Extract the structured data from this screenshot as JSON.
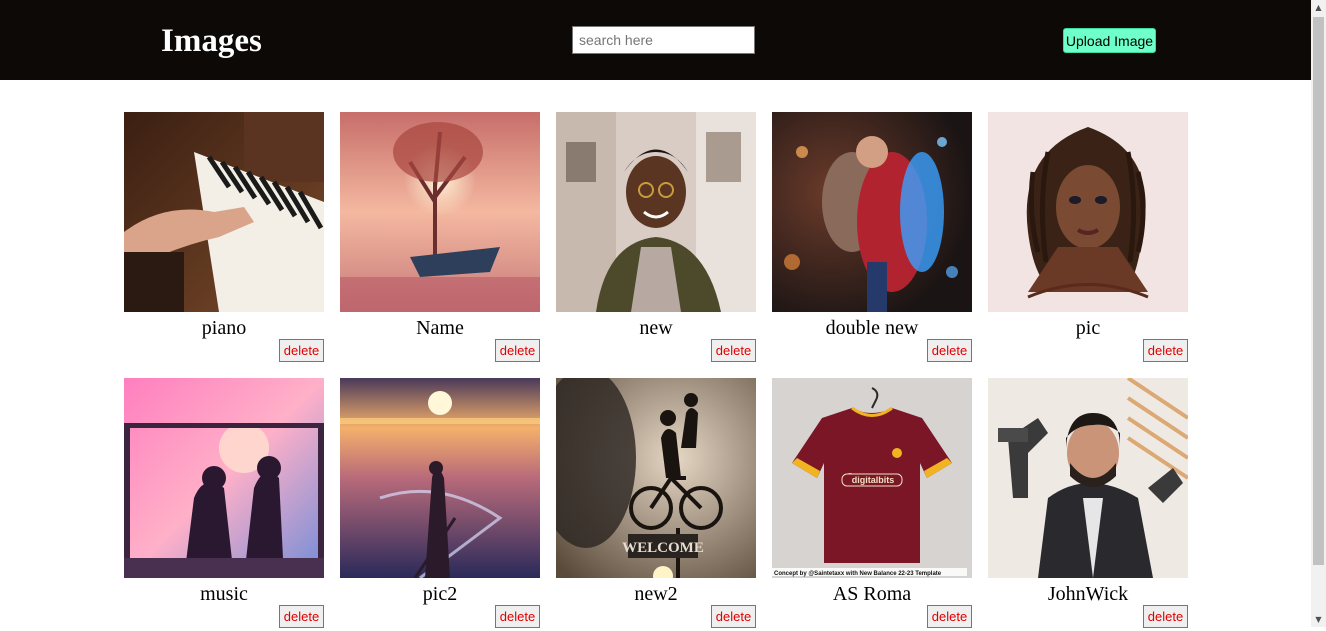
{
  "header": {
    "title": "Images",
    "search_placeholder": "search here",
    "search_value": "",
    "upload_label": "Upload Image"
  },
  "gallery": {
    "delete_label": "delete",
    "items": [
      {
        "name": "piano"
      },
      {
        "name": "Name"
      },
      {
        "name": "new"
      },
      {
        "name": "double new"
      },
      {
        "name": "pic"
      },
      {
        "name": "music"
      },
      {
        "name": "pic2"
      },
      {
        "name": "new2"
      },
      {
        "name": "AS Roma"
      },
      {
        "name": "JohnWick"
      }
    ],
    "jersey_caption": "Concept by @Saintetaxx with New Balance 22-23 Template",
    "jersey_logo": "digitalbits",
    "sign_text": "WELCOME"
  },
  "colors": {
    "header_bg": "#0c0906",
    "upload_bg": "#6fffc8",
    "delete_text": "#e00000"
  },
  "scrollbar": {
    "up_icon": "arrow-up-icon",
    "down_icon": "arrow-down-icon"
  }
}
